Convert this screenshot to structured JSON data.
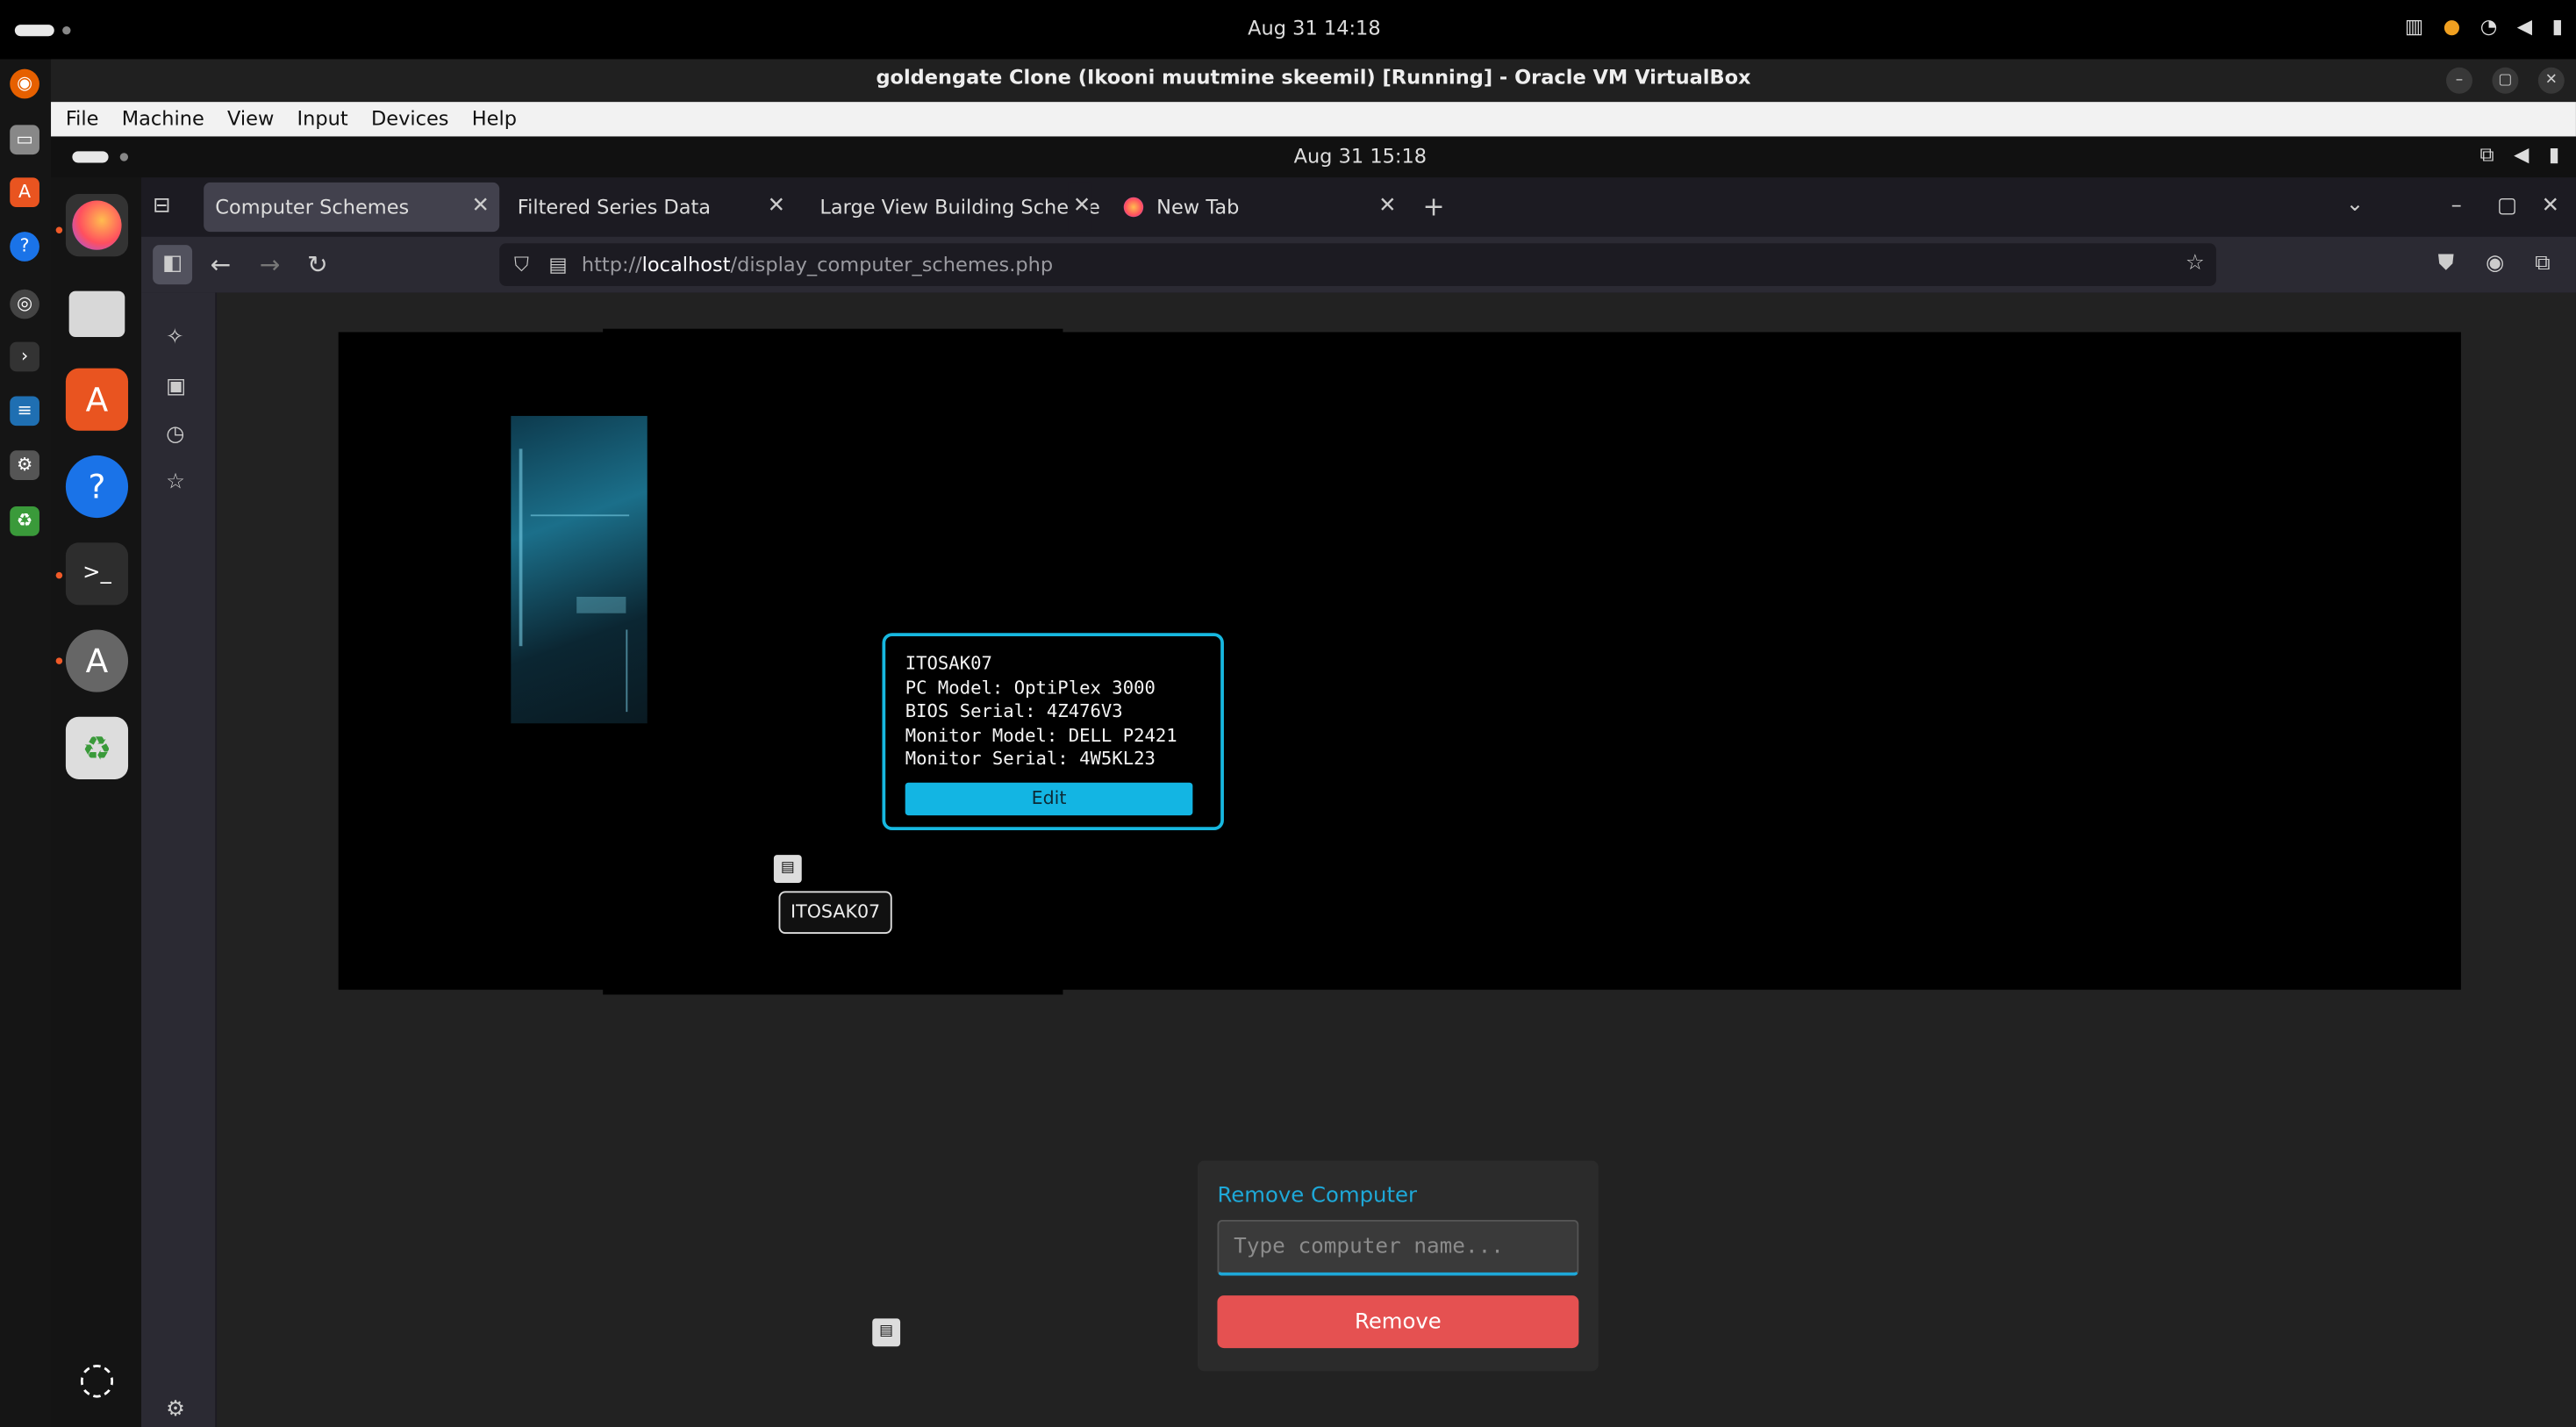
{
  "host": {
    "clock": "Aug 31  14:18",
    "window_title": "goldengate Clone (Ikooni muutmine skeemil) [Running] - Oracle VM VirtualBox",
    "menu": [
      "File",
      "Machine",
      "View",
      "Input",
      "Devices",
      "Help"
    ]
  },
  "guest": {
    "clock": "Aug 31  15:18"
  },
  "browser": {
    "tabs": [
      {
        "label": "Computer Schemes",
        "active": true
      },
      {
        "label": "Filtered Series Data",
        "active": false
      },
      {
        "label": "Large View Building Scheme",
        "active": false
      },
      {
        "label": "New Tab",
        "active": false
      }
    ],
    "url_prefix": "http://",
    "url_host": "localhost",
    "url_path": "/display_computer_schemes.php"
  },
  "page": {
    "popup": {
      "name": "ITOSAK07",
      "pc_model": "PC Model: OptiPlex 3000",
      "bios_serial": "BIOS Serial: 4Z476V3",
      "monitor_model": "Monitor Model: DELL P2421",
      "monitor_serial": "Monitor Serial: 4W5KL23",
      "edit_label": "Edit"
    },
    "computer_label": "ITOSAK07",
    "remove": {
      "title": "Remove Computer",
      "placeholder": "Type computer name...",
      "button": "Remove"
    }
  },
  "colors": {
    "accent": "#17b8e0",
    "danger": "#e55151"
  }
}
